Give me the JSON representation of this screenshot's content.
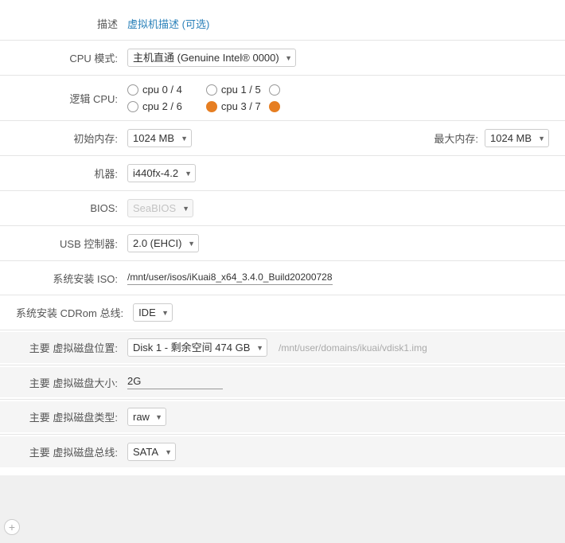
{
  "form": {
    "description_label": "描述",
    "description_link": "虚拟机描述 (可选)",
    "cpu_mode_label": "CPU 模式:",
    "cpu_mode_value": "主机直通 (Genuine Intel® 0000)",
    "logical_cpu_label": "逻辑 CPU:",
    "cpus": [
      {
        "id": "cpu0",
        "label": "cpu 0 / 4",
        "active": false
      },
      {
        "id": "cpu1",
        "label": "cpu 1 / 5",
        "active": false
      },
      {
        "id": "cpu2",
        "label": "cpu 2 / 6",
        "active": false
      },
      {
        "id": "cpu3",
        "label": "cpu 3 / 7",
        "active": true
      }
    ],
    "init_mem_label": "初始内存:",
    "init_mem_value": "1024 MB",
    "max_mem_label": "最大内存:",
    "max_mem_value": "1024 MB",
    "machine_label": "机器:",
    "machine_value": "i440fx-4.2",
    "bios_label": "BIOS:",
    "bios_value": "SeaBIOS",
    "usb_label": "USB 控制器:",
    "usb_value": "2.0 (EHCI)",
    "iso_label": "系统安装 ISO:",
    "iso_value": "/mnt/user/isos/iKuai8_x64_3.4.0_Build20200728",
    "cdrom_label": "系统安装 CDRom 总线:",
    "cdrom_value": "IDE",
    "vdisk_location_label": "主要 虚拟磁盘位置:",
    "vdisk_location_value": "Disk 1 - 剩余空间 474 GB",
    "vdisk_location_path": "/mnt/user/domains/ikuai/vdisk1.img",
    "vdisk_size_label": "主要 虚拟磁盘大小:",
    "vdisk_size_value": "2G",
    "vdisk_type_label": "主要 虚拟磁盘类型:",
    "vdisk_type_value": "raw",
    "vdisk_bus_label": "主要 虚拟磁盘总线:",
    "vdisk_bus_value": "SATA",
    "add_icon": "+"
  }
}
